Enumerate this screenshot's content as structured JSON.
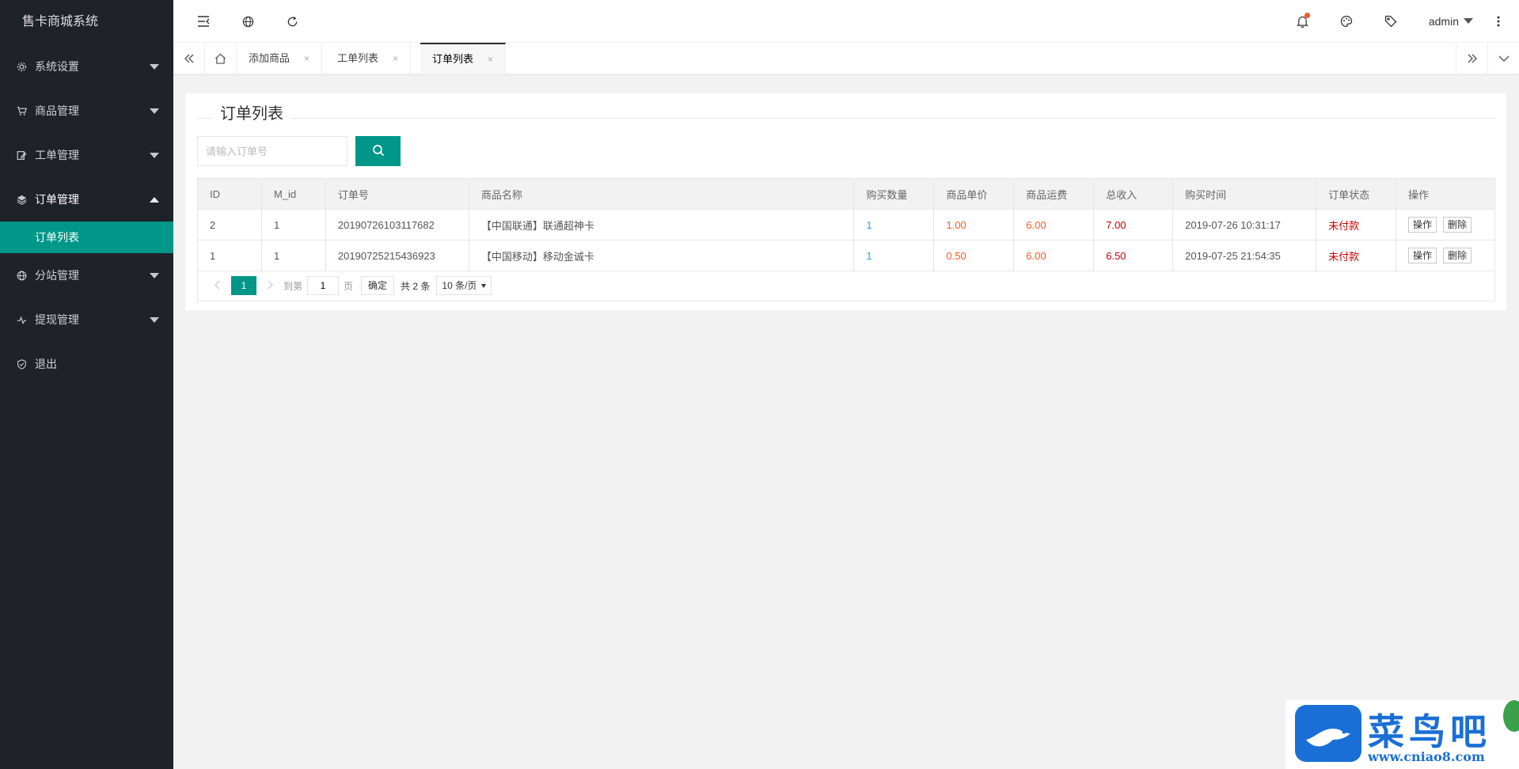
{
  "app": {
    "title": "售卡商城系统"
  },
  "sidebar": {
    "items": [
      {
        "label": "系统设置",
        "icon": "gear-icon"
      },
      {
        "label": "商品管理",
        "icon": "cart-icon"
      },
      {
        "label": "工单管理",
        "icon": "edit-icon"
      },
      {
        "label": "订单管理",
        "icon": "layers-icon",
        "open": true,
        "children": [
          {
            "label": "订单列表",
            "active": true
          }
        ]
      },
      {
        "label": "分站管理",
        "icon": "globe-icon"
      },
      {
        "label": "提现管理",
        "icon": "pulse-icon"
      },
      {
        "label": "退出",
        "icon": "shield-icon"
      }
    ]
  },
  "header": {
    "user": "admin",
    "icons": [
      "menu-toggle-icon",
      "globe-icon",
      "refresh-icon",
      "bell-icon",
      "palette-icon",
      "tag-icon",
      "more-vertical-icon"
    ],
    "accent": "#ff5722"
  },
  "tabs": {
    "items": [
      {
        "label": "添加商品",
        "closable": true
      },
      {
        "label": "工单列表",
        "closable": true
      },
      {
        "label": "订单列表",
        "closable": true,
        "active": true
      }
    ],
    "close_glyph": "×"
  },
  "main": {
    "title": "订单列表",
    "search": {
      "placeholder": "请输入订单号",
      "value": ""
    },
    "table": {
      "columns": [
        "ID",
        "M_id",
        "订单号",
        "商品名称",
        "购买数量",
        "商品单价",
        "商品运费",
        "总收入",
        "购买时间",
        "订单状态",
        "操作"
      ],
      "rows": [
        {
          "id": "2",
          "m_id": "1",
          "order_no": "20190726103117682",
          "product": "【中国联通】联通超神卡",
          "qty": "1",
          "price": "1.00",
          "shipping": "6.00",
          "total": "7.00",
          "time": "2019-07-26 10:31:17",
          "status": "未付款",
          "op": "操作",
          "del": "删除"
        },
        {
          "id": "1",
          "m_id": "1",
          "order_no": "20190725215436923",
          "product": "【中国移动】移动金诚卡",
          "qty": "1",
          "price": "0.50",
          "shipping": "6.00",
          "total": "6.50",
          "time": "2019-07-25 21:54:35",
          "status": "未付款",
          "op": "操作",
          "del": "删除"
        }
      ]
    },
    "pager": {
      "current": "1",
      "goto_label": "到第",
      "goto_value": "1",
      "page_label": "页",
      "confirm": "确定",
      "total": "共 2 条",
      "page_size": "10 条/页"
    }
  },
  "colors": {
    "primary": "#009688",
    "sidebar_bg": "#20222a",
    "link_blue": "#1E9FFF",
    "price_orange": "#FF5722",
    "status_red": "#cc0000"
  },
  "watermark": {
    "text": "菜鸟吧",
    "url": "www.cniao8.com"
  }
}
